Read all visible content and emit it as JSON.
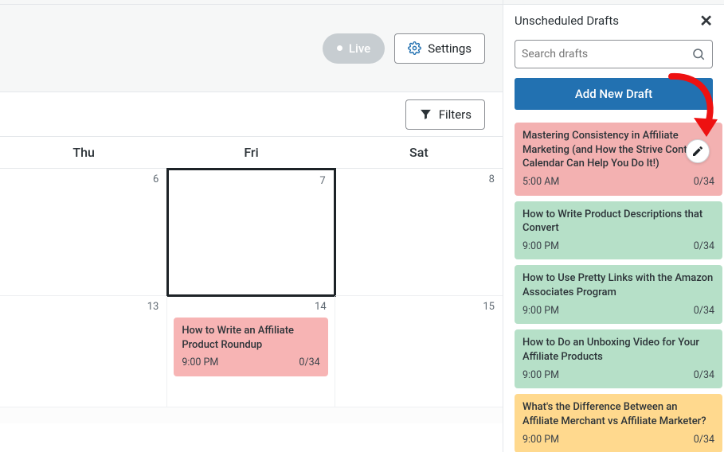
{
  "toolbar": {
    "live_label": "Live",
    "settings_label": "Settings",
    "filters_label": "Filters"
  },
  "calendar": {
    "day_headers": [
      "Thu",
      "Fri",
      "Sat"
    ],
    "week1": [
      {
        "num": "6"
      },
      {
        "num": "7",
        "today": true
      },
      {
        "num": "8"
      }
    ],
    "week2": [
      {
        "num": "13"
      },
      {
        "num": "14",
        "events": [
          {
            "title": "How to Write an Affiliate Product Roundup",
            "time": "9:00 PM",
            "count": "0/34",
            "color": "pink"
          }
        ]
      },
      {
        "num": "15"
      }
    ]
  },
  "panel": {
    "heading": "Unscheduled Drafts",
    "search_placeholder": "Search drafts",
    "add_label": "Add New Draft",
    "drafts": [
      {
        "title": "Mastering Consistency in Affiliate Marketing (and How the Strive Content Calendar Can Help You Do It!)",
        "time": "5:00 AM",
        "count": "0/34",
        "color": "pink"
      },
      {
        "title": "How to Write Product Descriptions that Convert",
        "time": "9:00 PM",
        "count": "0/34",
        "color": "green"
      },
      {
        "title": "How to Use Pretty Links with the Amazon Associates Program",
        "time": "9:00 PM",
        "count": "0/34",
        "color": "green"
      },
      {
        "title": "How to Do an Unboxing Video for Your Affiliate Products",
        "time": "9:00 PM",
        "count": "0/34",
        "color": "green"
      },
      {
        "title": "What's the Difference Between an Affiliate Merchant vs Affiliate Marketer?",
        "time": "9:00 PM",
        "count": "0/34",
        "color": "orange"
      }
    ]
  }
}
